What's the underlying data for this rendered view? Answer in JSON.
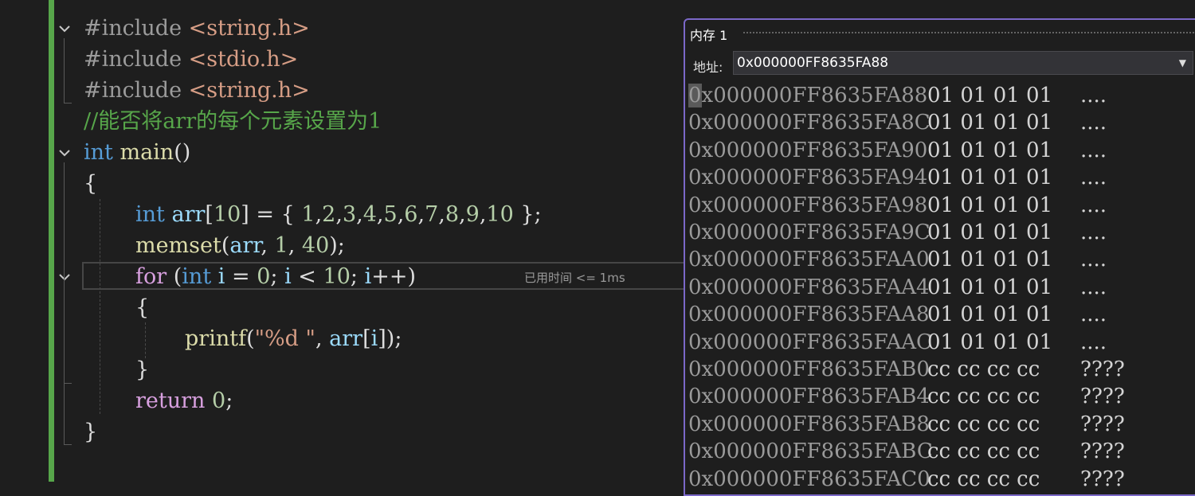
{
  "editor": {
    "lines": [
      [
        {
          "c": "c-pre",
          "t": "#include "
        },
        {
          "c": "c-str",
          "t": "<string.h>"
        }
      ],
      [
        {
          "c": "c-pre",
          "t": "#include "
        },
        {
          "c": "c-str",
          "t": "<stdio.h>"
        }
      ],
      [
        {
          "c": "c-pre",
          "t": "#include "
        },
        {
          "c": "c-str",
          "t": "<string.h>"
        }
      ],
      [
        {
          "c": "c-cmt",
          "t": "//能否将arr的每个元素设置为1"
        }
      ],
      [
        {
          "c": "c-kw",
          "t": "int "
        },
        {
          "c": "c-fn",
          "t": "main"
        },
        {
          "c": "c-pun",
          "t": "()"
        }
      ],
      [
        {
          "c": "c-pun",
          "t": "{"
        }
      ],
      [
        {
          "c": "c-kw",
          "t": "int "
        },
        {
          "c": "c-var",
          "t": "arr"
        },
        {
          "c": "c-pun",
          "t": "["
        },
        {
          "c": "c-num",
          "t": "10"
        },
        {
          "c": "c-pun",
          "t": "] = { "
        },
        {
          "c": "c-num",
          "t": "1"
        },
        {
          "c": "c-pun",
          "t": ","
        },
        {
          "c": "c-num",
          "t": "2"
        },
        {
          "c": "c-pun",
          "t": ","
        },
        {
          "c": "c-num",
          "t": "3"
        },
        {
          "c": "c-pun",
          "t": ","
        },
        {
          "c": "c-num",
          "t": "4"
        },
        {
          "c": "c-pun",
          "t": ","
        },
        {
          "c": "c-num",
          "t": "5"
        },
        {
          "c": "c-pun",
          "t": ","
        },
        {
          "c": "c-num",
          "t": "6"
        },
        {
          "c": "c-pun",
          "t": ","
        },
        {
          "c": "c-num",
          "t": "7"
        },
        {
          "c": "c-pun",
          "t": ","
        },
        {
          "c": "c-num",
          "t": "8"
        },
        {
          "c": "c-pun",
          "t": ","
        },
        {
          "c": "c-num",
          "t": "9"
        },
        {
          "c": "c-pun",
          "t": ","
        },
        {
          "c": "c-num",
          "t": "10"
        },
        {
          "c": "c-pun",
          "t": " };"
        }
      ],
      [
        {
          "c": "c-fn",
          "t": "memset"
        },
        {
          "c": "c-pun",
          "t": "("
        },
        {
          "c": "c-var",
          "t": "arr"
        },
        {
          "c": "c-pun",
          "t": ", "
        },
        {
          "c": "c-num",
          "t": "1"
        },
        {
          "c": "c-pun",
          "t": ", "
        },
        {
          "c": "c-num",
          "t": "40"
        },
        {
          "c": "c-pun",
          "t": ");"
        }
      ],
      [
        {
          "c": "c-ctl",
          "t": "for "
        },
        {
          "c": "c-pun",
          "t": "("
        },
        {
          "c": "c-kw",
          "t": "int "
        },
        {
          "c": "c-var",
          "t": "i"
        },
        {
          "c": "c-pun",
          "t": " = "
        },
        {
          "c": "c-num",
          "t": "0"
        },
        {
          "c": "c-pun",
          "t": "; "
        },
        {
          "c": "c-var",
          "t": "i"
        },
        {
          "c": "c-pun",
          "t": " < "
        },
        {
          "c": "c-num",
          "t": "10"
        },
        {
          "c": "c-pun",
          "t": "; "
        },
        {
          "c": "c-var",
          "t": "i"
        },
        {
          "c": "c-pun",
          "t": "++)"
        }
      ],
      [
        {
          "c": "c-pun",
          "t": "{"
        }
      ],
      [
        {
          "c": "c-fn",
          "t": "printf"
        },
        {
          "c": "c-pun",
          "t": "("
        },
        {
          "c": "c-str",
          "t": "\"%d \""
        },
        {
          "c": "c-pun",
          "t": ", "
        },
        {
          "c": "c-var",
          "t": "arr"
        },
        {
          "c": "c-pun",
          "t": "["
        },
        {
          "c": "c-var",
          "t": "i"
        },
        {
          "c": "c-pun",
          "t": "]);"
        }
      ],
      [
        {
          "c": "c-pun",
          "t": "}"
        }
      ],
      [
        {
          "c": "c-ctl",
          "t": "return "
        },
        {
          "c": "c-num",
          "t": "0"
        },
        {
          "c": "c-pun",
          "t": ";"
        }
      ],
      [
        {
          "c": "c-pun",
          "t": "}"
        }
      ]
    ],
    "perf_tip": "已用时间 <= 1ms"
  },
  "memory": {
    "title": "内存 1",
    "address_label": "地址:",
    "address_value": "0x000000FF8635FA88",
    "dropdown_icon": "chevron-down-icon",
    "rows": [
      {
        "addr": "0x000000FF8635FA88",
        "bytes": "01 01 01 01",
        "ascii": "...."
      },
      {
        "addr": "0x000000FF8635FA8C",
        "bytes": "01 01 01 01",
        "ascii": "...."
      },
      {
        "addr": "0x000000FF8635FA90",
        "bytes": "01 01 01 01",
        "ascii": "...."
      },
      {
        "addr": "0x000000FF8635FA94",
        "bytes": "01 01 01 01",
        "ascii": "...."
      },
      {
        "addr": "0x000000FF8635FA98",
        "bytes": "01 01 01 01",
        "ascii": "...."
      },
      {
        "addr": "0x000000FF8635FA9C",
        "bytes": "01 01 01 01",
        "ascii": "...."
      },
      {
        "addr": "0x000000FF8635FAA0",
        "bytes": "01 01 01 01",
        "ascii": "...."
      },
      {
        "addr": "0x000000FF8635FAA4",
        "bytes": "01 01 01 01",
        "ascii": "...."
      },
      {
        "addr": "0x000000FF8635FAA8",
        "bytes": "01 01 01 01",
        "ascii": "...."
      },
      {
        "addr": "0x000000FF8635FAAC",
        "bytes": "01 01 01 01",
        "ascii": "...."
      },
      {
        "addr": "0x000000FF8635FAB0",
        "bytes": "cc cc cc cc",
        "ascii": "????"
      },
      {
        "addr": "0x000000FF8635FAB4",
        "bytes": "cc cc cc cc",
        "ascii": "????"
      },
      {
        "addr": "0x000000FF8635FAB8",
        "bytes": "cc cc cc cc",
        "ascii": "????"
      },
      {
        "addr": "0x000000FF8635FABC",
        "bytes": "cc cc cc cc",
        "ascii": "????"
      },
      {
        "addr": "0x000000FF8635FAC0",
        "bytes": "cc cc cc cc",
        "ascii": "????"
      }
    ]
  }
}
